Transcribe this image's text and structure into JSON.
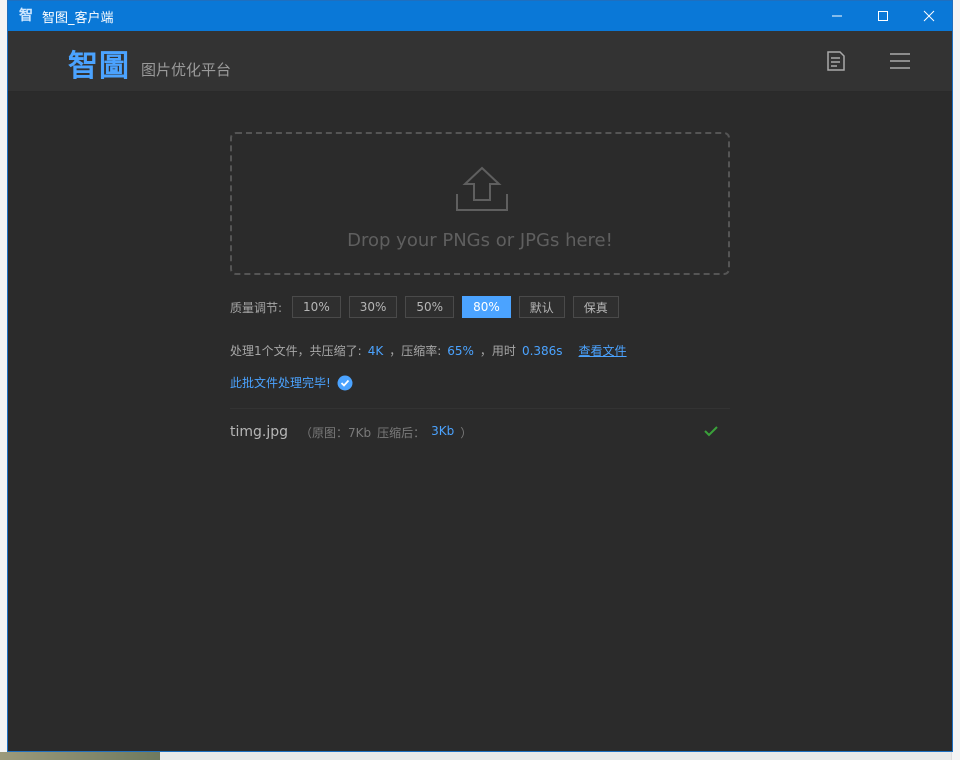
{
  "window": {
    "title": "智图_客户端",
    "app_icon_glyph": "智"
  },
  "header": {
    "logo_text": "智圖",
    "subtitle": "图片优化平台"
  },
  "dropzone": {
    "text": "Drop your PNGs or JPGs here!"
  },
  "quality": {
    "label": "质量调节:",
    "options": [
      "10%",
      "30%",
      "50%",
      "80%",
      "默认",
      "保真"
    ],
    "selected": "80%"
  },
  "summary": {
    "part1": "处理1个文件，共压缩了:",
    "compressed": "4K",
    "part2": "，压缩率:",
    "ratio": "65%",
    "part3": "，用时",
    "time": "0.386s",
    "view_link": "查看文件"
  },
  "batch": {
    "done_text": "此批文件处理完毕!"
  },
  "file": {
    "name": "timg.jpg",
    "original_label": "（原图：7Kb",
    "after_label": "压缩后：",
    "after_value": "3Kb",
    "close_paren": "）"
  },
  "colors": {
    "accent": "#4ba3ff",
    "titlebar": "#0a78d7",
    "background": "#2b2b2b",
    "success": "#3aa13a"
  }
}
